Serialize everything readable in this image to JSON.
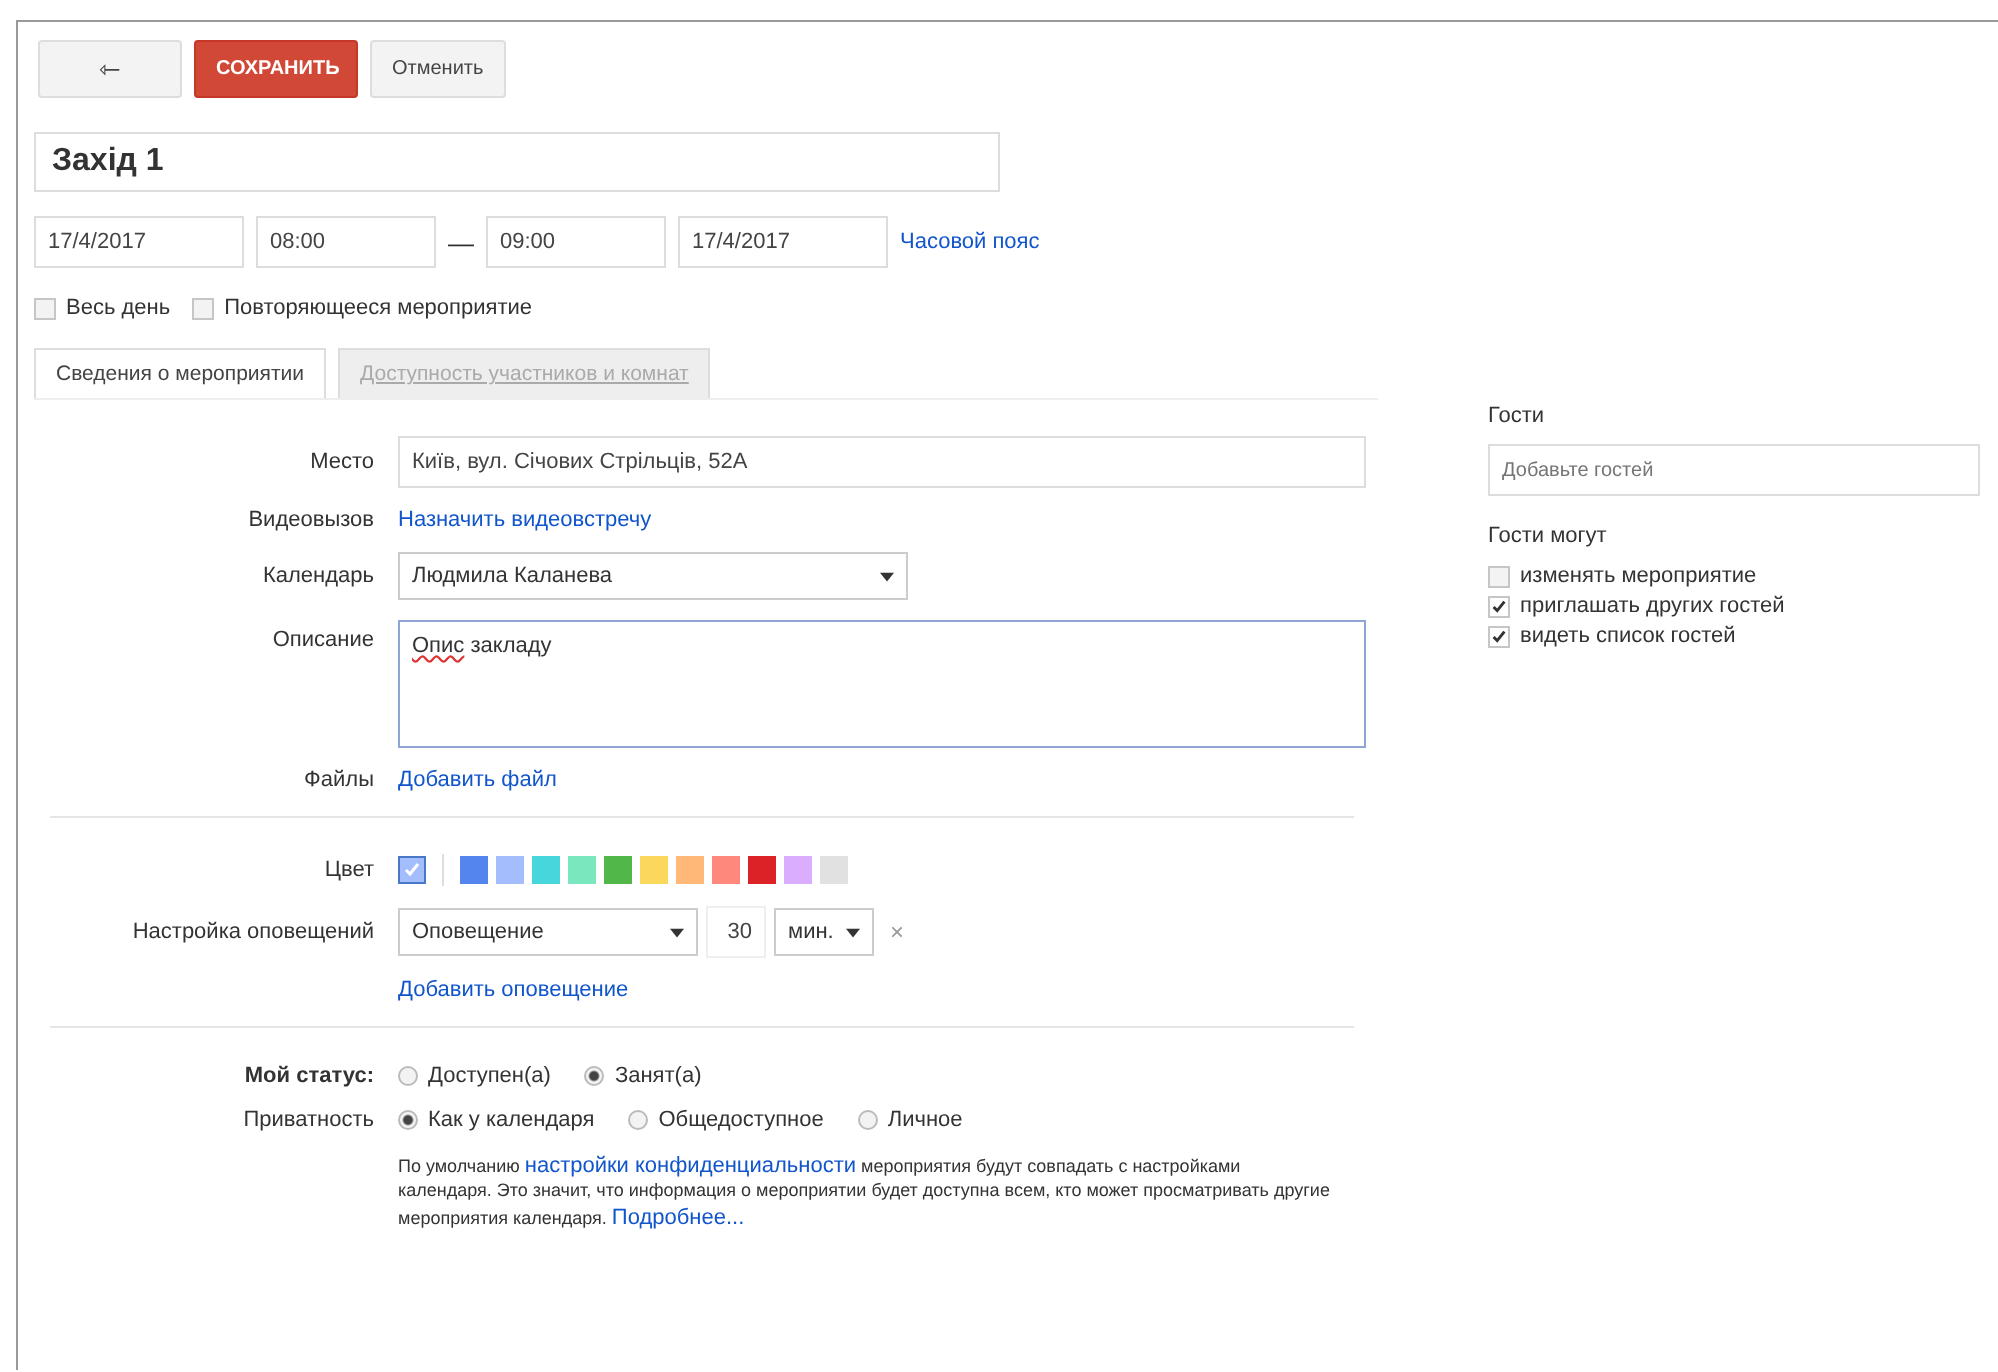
{
  "toolbar": {
    "back": "⇽",
    "save": "СОХРАНИТЬ",
    "cancel": "Отменить"
  },
  "title": "Захід 1",
  "dates": {
    "start_date": "17/4/2017",
    "start_time": "08:00",
    "dash": "—",
    "end_time": "09:00",
    "end_date": "17/4/2017",
    "timezone": "Часовой пояс"
  },
  "options": [
    {
      "label": "Весь день",
      "checked": false
    },
    {
      "label": "Повторяющееся мероприятие",
      "checked": false
    }
  ],
  "tabs": [
    {
      "label": "Сведения о мероприятии",
      "selected": true
    },
    {
      "label": "Доступность участников и комнат",
      "selected": false
    }
  ],
  "details": {
    "place_label": "Место",
    "place": "Київ, вул. Січових Стрільців, 52А",
    "video_label": "Видеовызов",
    "video_link": "Назначить видеовстречу",
    "calendar_label": "Календарь",
    "calendar": "Людмила Каланева",
    "description_label": "Описание",
    "description_misspelled": "Опис",
    "description_rest": "закладу",
    "files_label": "Файлы",
    "files_link": "Добавить файл"
  },
  "color_label": "Цвет",
  "colors": [
    {
      "color": "#a4bdfc",
      "selected": true
    },
    {
      "color": "#5484ed",
      "selected": false
    },
    {
      "color": "#a4bdfc",
      "selected": false
    },
    {
      "color": "#46d6db",
      "selected": false
    },
    {
      "color": "#7ae7bf",
      "selected": false
    },
    {
      "color": "#51b749",
      "selected": false
    },
    {
      "color": "#fbd75b",
      "selected": false
    },
    {
      "color": "#ffb878",
      "selected": false
    },
    {
      "color": "#ff887c",
      "selected": false
    },
    {
      "color": "#dc2127",
      "selected": false
    },
    {
      "color": "#dbadff",
      "selected": false
    },
    {
      "color": "#e1e1e1",
      "selected": false
    }
  ],
  "notifications": {
    "label": "Настройка оповещений",
    "type": "Оповещение",
    "amount": "30",
    "unit": "мин.",
    "remove": "×",
    "add_link": "Добавить оповещение"
  },
  "status": {
    "label": "Мой статус:",
    "options": [
      {
        "label": "Доступен(а)",
        "selected": false
      },
      {
        "label": "Занят(а)",
        "selected": true
      }
    ]
  },
  "privacy": {
    "label": "Приватность",
    "options": [
      {
        "label": "Как у календаря",
        "selected": true
      },
      {
        "label": "Общедоступное",
        "selected": false
      },
      {
        "label": "Личное",
        "selected": false
      }
    ]
  },
  "privacy_note": [
    {
      "kind": "text",
      "text": "По умолчанию "
    },
    {
      "kind": "link",
      "text": "настройки конфиденциальности"
    },
    {
      "kind": "text",
      "text": " мероприятия будут совпадать с настройками календаря. Это значит, что информация о мероприятии будет доступна всем, кто может просматривать другие мероприятия календаря. "
    },
    {
      "kind": "link",
      "text": "Подробнее..."
    }
  ],
  "guests": {
    "title": "Гости",
    "placeholder": "Добавьте гостей",
    "can_title": "Гости могут",
    "permissions": [
      {
        "label": "изменять мероприятие",
        "checked": false
      },
      {
        "label": "приглашать других гостей",
        "checked": true
      },
      {
        "label": "видеть список гостей",
        "checked": true
      }
    ]
  }
}
